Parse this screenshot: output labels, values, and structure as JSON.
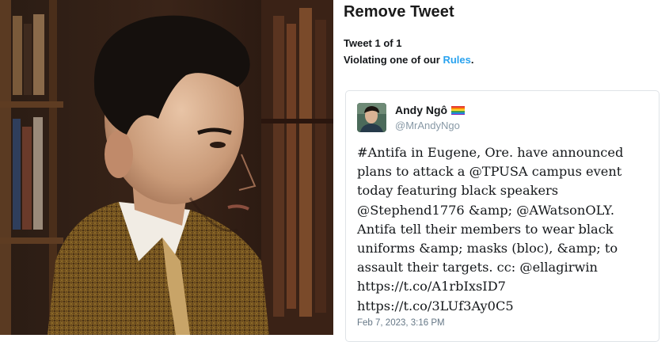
{
  "dialog": {
    "title": "Remove Tweet",
    "counter": "Tweet 1 of 1",
    "violation_prefix": "Violating one of our ",
    "violation_link": "Rules",
    "violation_suffix": "."
  },
  "tweet": {
    "name": "Andy Ngô",
    "flag_icon": "rainbow-flag-icon",
    "handle": "@MrAndyNgo",
    "text": "#Antifa in Eugene, Ore. have announced\nplans to attack a @TPUSA campus event\ntoday featuring black speakers\n@Stephend1776 &amp; @AWatsonOLY.\nAntifa tell their members to wear black\nuniforms &amp; masks (bloc), &amp; to\nassault their targets. cc: @ellagirwin\nhttps://t.co/A1rbIxsID7\nhttps://t.co/3LUf3Ay0C5",
    "timestamp": "Feb 7, 2023, 3:16 PM"
  },
  "colors": {
    "link": "#2aa3ef",
    "card_border": "#dfe3e7",
    "muted": "#8899a6"
  }
}
